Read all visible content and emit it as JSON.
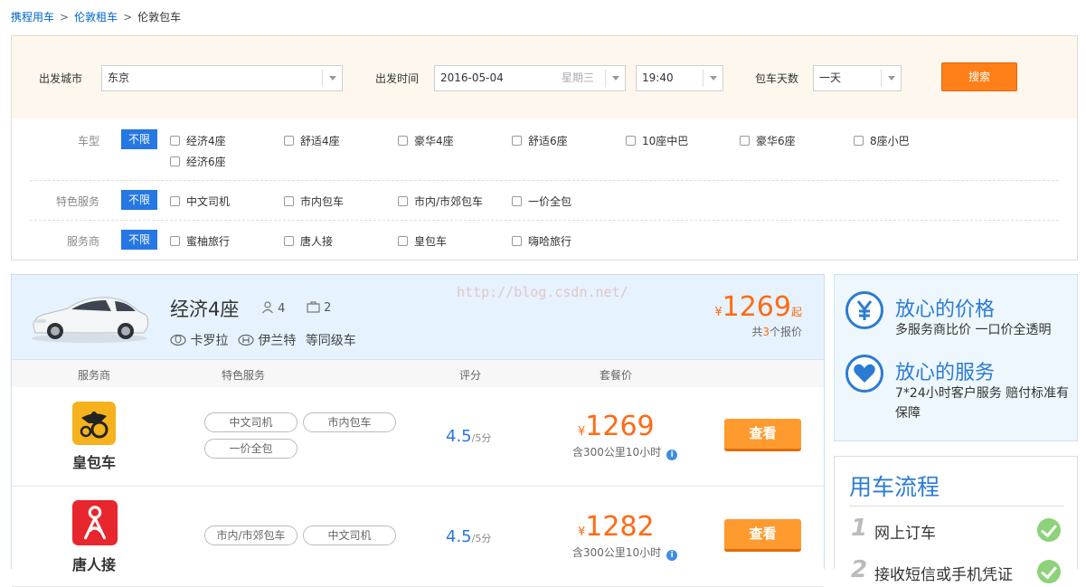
{
  "breadcrumb": {
    "items": [
      "携程用车",
      "伦敦租车",
      "伦敦包车"
    ],
    "separator": ">"
  },
  "search": {
    "city_label": "出发城市",
    "city_value": "东京",
    "time_label": "出发时间",
    "date_value": "2016-05-04",
    "weekday": "星期三",
    "time_value": "19:40",
    "days_label": "包车天数",
    "days_value": "一天",
    "search_button": "搜索",
    "button_color": "#ff7f18"
  },
  "filters": {
    "all_label": "不限",
    "car_type": {
      "label": "车型",
      "options": [
        "经济4座",
        "舒适4座",
        "豪华4座",
        "舒适6座",
        "10座中巴",
        "豪华6座",
        "8座小巴",
        "经济6座"
      ]
    },
    "service": {
      "label": "特色服务",
      "options": [
        "中文司机",
        "市内包车",
        "市内/市郊包车",
        "一价全包"
      ]
    },
    "vendor": {
      "label": "服务商",
      "options": [
        "蜜柚旅行",
        "唐人接",
        "皇包车",
        "嗨哈旅行"
      ]
    }
  },
  "result": {
    "car_class": "经济4座",
    "seats": "4",
    "luggage": "2",
    "models": [
      "卡罗拉",
      "伊兰特",
      "等同级车"
    ],
    "currency": "¥",
    "from_price": "1269",
    "from_suffix": "起",
    "quotes_prefix": "共",
    "quotes_count": "3",
    "quotes_suffix": "个报价",
    "watermark": "http://blog.csdn.net/",
    "columns": [
      "服务商",
      "特色服务",
      "评分",
      "套餐价"
    ],
    "rows": [
      {
        "vendor": "皇包车",
        "logo_color": "#f5b21d",
        "services": [
          "中文司机",
          "市内包车",
          "一价全包"
        ],
        "score": "4.5",
        "score_max": "/5分",
        "price": "1269",
        "note": "含300公里10小时",
        "button": "查看"
      },
      {
        "vendor": "唐人接",
        "logo_color": "#e8262d",
        "services": [
          "市内/市郊包车",
          "中文司机"
        ],
        "score": "4.5",
        "score_max": "/5分",
        "price": "1282",
        "note": "含300公里10小时",
        "button": "查看"
      }
    ]
  },
  "assurance": {
    "items": [
      {
        "icon": "yen-icon",
        "title": "放心的价格",
        "desc": "多服务商比价 一口价全透明"
      },
      {
        "icon": "heart-icon",
        "title": "放心的服务",
        "desc": "7*24小时客户服务 赔付标准有保障"
      }
    ]
  },
  "flow": {
    "title": "用车流程",
    "steps": [
      {
        "num": "1",
        "text": "网上订车"
      },
      {
        "num": "2",
        "text": "接收短信或手机凭证"
      }
    ]
  },
  "colors": {
    "accent_blue": "#2577e3",
    "price_orange": "#ff6a13",
    "view_button": "#ff9a2e"
  }
}
